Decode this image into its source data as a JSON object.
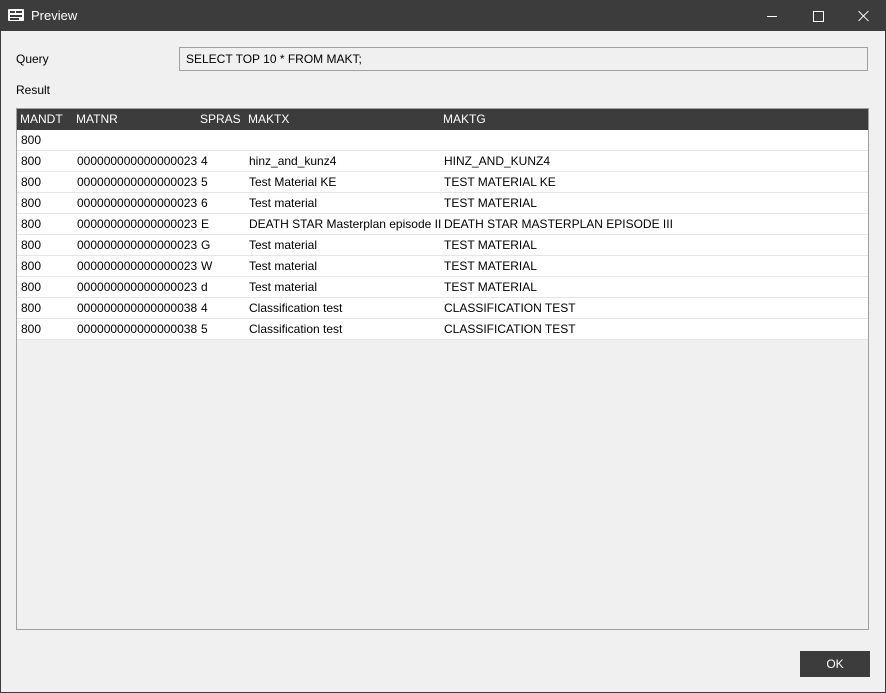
{
  "window": {
    "title": "Preview",
    "app_icon": "app-logo-icon",
    "buttons": {
      "minimize": "minimize-icon",
      "maximize": "maximize-icon",
      "close": "close-icon"
    }
  },
  "query": {
    "label": "Query",
    "value": "SELECT TOP 10 * FROM MAKT;"
  },
  "result": {
    "label": "Result",
    "columns": [
      "MANDT",
      "MATNR",
      "SPRAS",
      "MAKTX",
      "MAKTG"
    ],
    "rows": [
      [
        "800",
        "",
        "",
        "",
        ""
      ],
      [
        "800",
        "000000000000000023",
        "4",
        "hinz_and_kunz4",
        "HINZ_AND_KUNZ4"
      ],
      [
        "800",
        "000000000000000023",
        "5",
        "Test Material KE",
        "TEST MATERIAL KE"
      ],
      [
        "800",
        "000000000000000023",
        "6",
        "Test material",
        "TEST MATERIAL"
      ],
      [
        "800",
        "000000000000000023",
        "E",
        "DEATH STAR Masterplan episode III",
        "DEATH STAR MASTERPLAN EPISODE III"
      ],
      [
        "800",
        "000000000000000023",
        "G",
        "Test material",
        "TEST MATERIAL"
      ],
      [
        "800",
        "000000000000000023",
        "W",
        "Test material",
        "TEST MATERIAL"
      ],
      [
        "800",
        "000000000000000023",
        "d",
        "Test material",
        "TEST MATERIAL"
      ],
      [
        "800",
        "000000000000000038",
        "4",
        "Classification test",
        "CLASSIFICATION TEST"
      ],
      [
        "800",
        "000000000000000038",
        "5",
        "Classification test",
        "CLASSIFICATION TEST"
      ]
    ]
  },
  "footer": {
    "ok_label": "OK"
  },
  "colors": {
    "titlebar": "#3c3c3c",
    "background": "#f0f0f0",
    "header": "#3c3c3c",
    "row": "#ffffff"
  }
}
